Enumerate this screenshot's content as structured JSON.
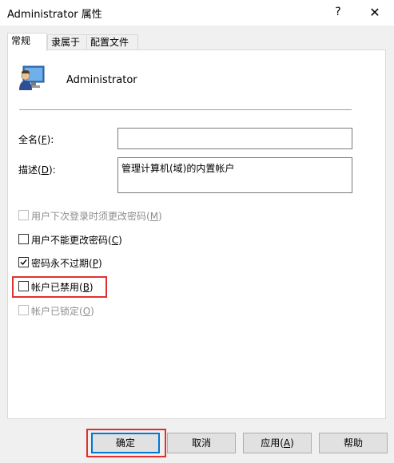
{
  "window": {
    "title": "Administrator 属性",
    "help_glyph": "?",
    "close_glyph": "✕"
  },
  "tabs": [
    {
      "label": "常规",
      "active": true
    },
    {
      "label": "隶属于",
      "active": false
    },
    {
      "label": "配置文件",
      "active": false
    }
  ],
  "user": {
    "name": "Administrator",
    "icon": "user-icon"
  },
  "fields": {
    "fullname": {
      "label_pre": "全名(",
      "label_key": "F",
      "label_post": "):",
      "value": ""
    },
    "description": {
      "label_pre": "描述(",
      "label_key": "D",
      "label_post": "):",
      "value": "管理计算机(域)的内置帐户"
    }
  },
  "checkboxes": [
    {
      "pre": "用户下次登录时须更改密码(",
      "key": "M",
      "post": ")",
      "checked": false,
      "disabled": true
    },
    {
      "pre": "用户不能更改密码(",
      "key": "C",
      "post": ")",
      "checked": false,
      "disabled": false
    },
    {
      "pre": "密码永不过期(",
      "key": "P",
      "post": ")",
      "checked": true,
      "disabled": false
    },
    {
      "pre": "帐户已禁用(",
      "key": "B",
      "post": ")",
      "checked": false,
      "disabled": false
    },
    {
      "pre": "帐户已锁定(",
      "key": "O",
      "post": ")",
      "checked": false,
      "disabled": true
    }
  ],
  "buttons": {
    "ok": "确定",
    "cancel": "取消",
    "apply_pre": "应用(",
    "apply_key": "A",
    "apply_post": ")",
    "help": "帮助"
  },
  "colors": {
    "highlight": "#e03131",
    "default_button_border": "#0078d7"
  }
}
